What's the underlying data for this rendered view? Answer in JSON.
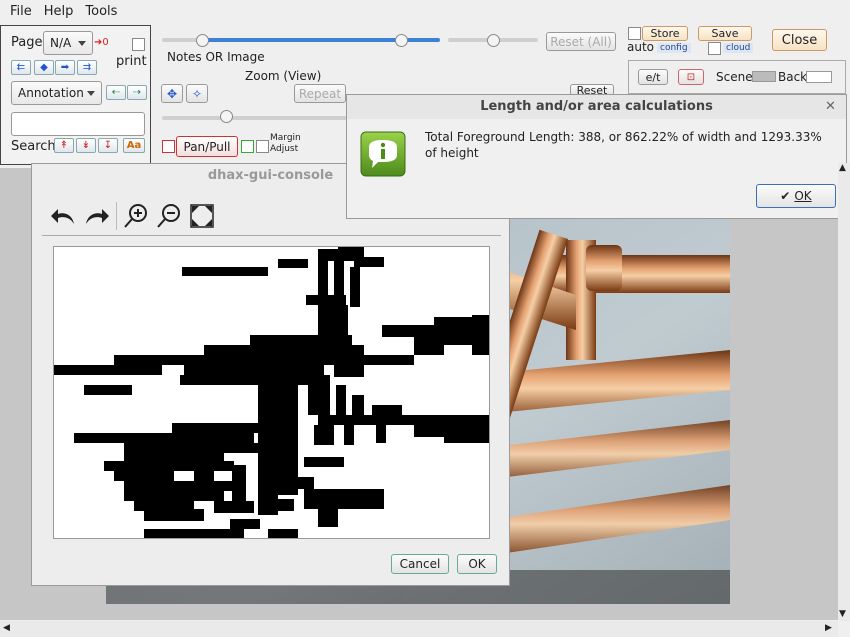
{
  "menubar": {
    "file": "File",
    "help": "Help",
    "tools": "Tools"
  },
  "left_panel": {
    "page_label": "Page",
    "page_value": "N/A",
    "page_arrow": "➜0",
    "print_label": "print",
    "annotation_value": "Annotation",
    "search_label": "Search",
    "search_value": "",
    "case_label": "Aa"
  },
  "top": {
    "notes_label": "Notes OR Image",
    "zoom_label": "Zoom (View)",
    "reset_all_label": "Reset (All)",
    "repeat_label": "Repeat",
    "reset_label": "Reset",
    "pan_pull_label": "Pan/Pull",
    "margin_label": "Margin",
    "adjust_label": "Adjust",
    "auto_label": "auto",
    "store_label": "Store",
    "config_label": "config",
    "save_label": "Save",
    "cloud_label": "cloud",
    "close_label": "Close",
    "et_label": "e/t",
    "scene_label": "Scene",
    "back_label": "Back"
  },
  "console_dialog": {
    "title": "dhax-gui-console",
    "cancel_label": "Cancel",
    "ok_label": "OK"
  },
  "length_dialog": {
    "title": "Length and/or area calculations",
    "message": "Total Foreground Length: 388, or 862.22% of width and 1293.33% of height",
    "ok_label": "OK"
  },
  "icons": {
    "undo": "undo-icon",
    "redo": "redo-icon",
    "zoom_in": "zoom-in-icon",
    "zoom_out": "zoom-out-icon",
    "fit": "fit-screen-icon",
    "info": "info-icon"
  },
  "colors": {
    "accent_blue": "#3b82d6",
    "info_green": "#6aa52c",
    "pan_red": "#cc3333"
  }
}
